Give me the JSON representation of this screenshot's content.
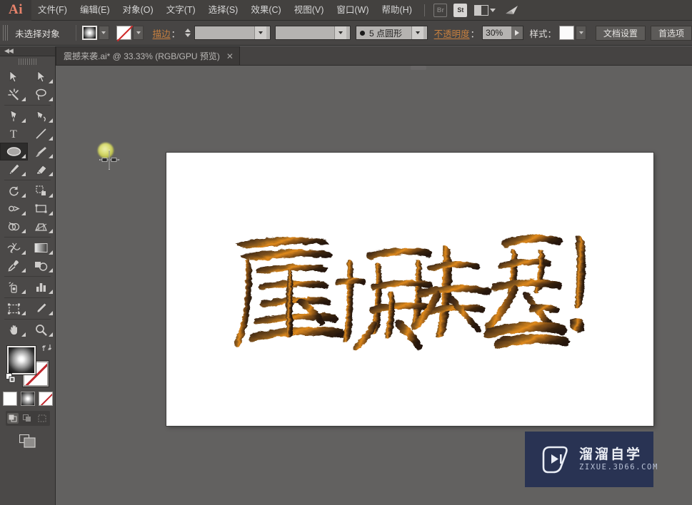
{
  "app": {
    "name": "Adobe Illustrator",
    "logo_text": "Ai",
    "accent_color": "#e8836b",
    "chrome_color": "#43413f",
    "canvas_color": "#626160"
  },
  "menubar": {
    "items": [
      {
        "label": "文件(F)"
      },
      {
        "label": "编辑(E)"
      },
      {
        "label": "对象(O)"
      },
      {
        "label": "文字(T)"
      },
      {
        "label": "选择(S)"
      },
      {
        "label": "效果(C)"
      },
      {
        "label": "视图(V)"
      },
      {
        "label": "窗口(W)"
      },
      {
        "label": "帮助(H)"
      }
    ],
    "right_icons": [
      {
        "name": "bridge-icon",
        "label": "Br"
      },
      {
        "name": "stock-icon",
        "label": "St"
      },
      {
        "name": "arrange-documents-icon",
        "label": ""
      },
      {
        "name": "workspace-switcher-icon",
        "label": ""
      }
    ]
  },
  "controlbar": {
    "selection_status": "未选择对象",
    "fill_label": "填色",
    "stroke_label": "描边",
    "stroke_label_suffix": "：",
    "stroke_weight_value": "",
    "stroke_profile_value": "",
    "brush_definition": "5 点圆形",
    "opacity_label": "不透明度",
    "opacity_label_suffix": "：",
    "opacity_value": "30%",
    "style_label": "样式：",
    "doc_setup_button": "文档设置",
    "preferences_button": "首选项"
  },
  "tabbar": {
    "tabs": [
      {
        "title": "震撼来袭.ai* @ 33.33% (RGB/GPU 预览)",
        "close_glyph": "✕",
        "active": true
      }
    ]
  },
  "toolbar": {
    "collapse_glyph": "◀◀",
    "tools": [
      {
        "name": "selection-tool",
        "label": "选择工具"
      },
      {
        "name": "direct-selection-tool",
        "label": "直接选择工具"
      },
      {
        "name": "magic-wand-tool",
        "label": "魔棒工具"
      },
      {
        "name": "lasso-tool",
        "label": "套索工具"
      },
      {
        "name": "pen-tool",
        "label": "钢笔工具"
      },
      {
        "name": "curvature-tool",
        "label": "曲率工具"
      },
      {
        "name": "type-tool",
        "label": "文字工具"
      },
      {
        "name": "line-segment-tool",
        "label": "直线段工具"
      },
      {
        "name": "ellipse-tool",
        "label": "椭圆工具",
        "active": true
      },
      {
        "name": "paintbrush-tool",
        "label": "画笔工具"
      },
      {
        "name": "pencil-tool",
        "label": "铅笔工具"
      },
      {
        "name": "eraser-tool",
        "label": "橡皮擦工具"
      },
      {
        "name": "rotate-tool",
        "label": "旋转工具"
      },
      {
        "name": "scale-tool",
        "label": "比例缩放工具"
      },
      {
        "name": "width-tool",
        "label": "宽度工具"
      },
      {
        "name": "free-transform-tool",
        "label": "自由变换工具"
      },
      {
        "name": "shape-builder-tool",
        "label": "形状生成器工具"
      },
      {
        "name": "gradient-tool",
        "label": "渐变工具"
      },
      {
        "name": "eyedropper-tool",
        "label": "吸管工具"
      },
      {
        "name": "blend-tool",
        "label": "混合工具"
      },
      {
        "name": "symbol-sprayer-tool",
        "label": "符号喷枪工具"
      },
      {
        "name": "column-graph-tool",
        "label": "柱形图工具"
      },
      {
        "name": "artboard-tool",
        "label": "画板工具"
      },
      {
        "name": "slice-tool",
        "label": "切片工具"
      },
      {
        "name": "hand-tool",
        "label": "抓手工具"
      },
      {
        "name": "zoom-tool",
        "label": "缩放工具"
      }
    ],
    "fill_swatch": {
      "name": "fill-swatch",
      "type": "gradient",
      "label": "填色"
    },
    "stroke_swatch": {
      "name": "stroke-swatch",
      "type": "none",
      "label": "描边"
    },
    "color_modes": [
      {
        "name": "color-button",
        "label": "颜色"
      },
      {
        "name": "gradient-button",
        "label": "渐变"
      },
      {
        "name": "none-button",
        "label": "无"
      }
    ],
    "draw_modes": [
      {
        "name": "draw-normal-mode",
        "label": "正常绘图",
        "selected": true
      },
      {
        "name": "draw-behind-mode",
        "label": "背面绘图"
      },
      {
        "name": "draw-inside-mode",
        "label": "内部绘图"
      }
    ],
    "screen_mode": {
      "name": "screen-mode-button",
      "label": "更改屏幕模式"
    }
  },
  "canvas": {
    "artwork_text": "震撼来袭！",
    "artwork_description": "毛笔书法字 — 震撼来袭！",
    "zoom_level": "33.33%",
    "drawn_object": {
      "name": "gradient-ellipse",
      "color": "#d9dc72"
    },
    "cursor": "crosshair"
  },
  "watermark": {
    "brand_cn": "溜溜自学",
    "brand_url": "ZIXUE.3D66.COM",
    "bg_color": "#293353"
  }
}
